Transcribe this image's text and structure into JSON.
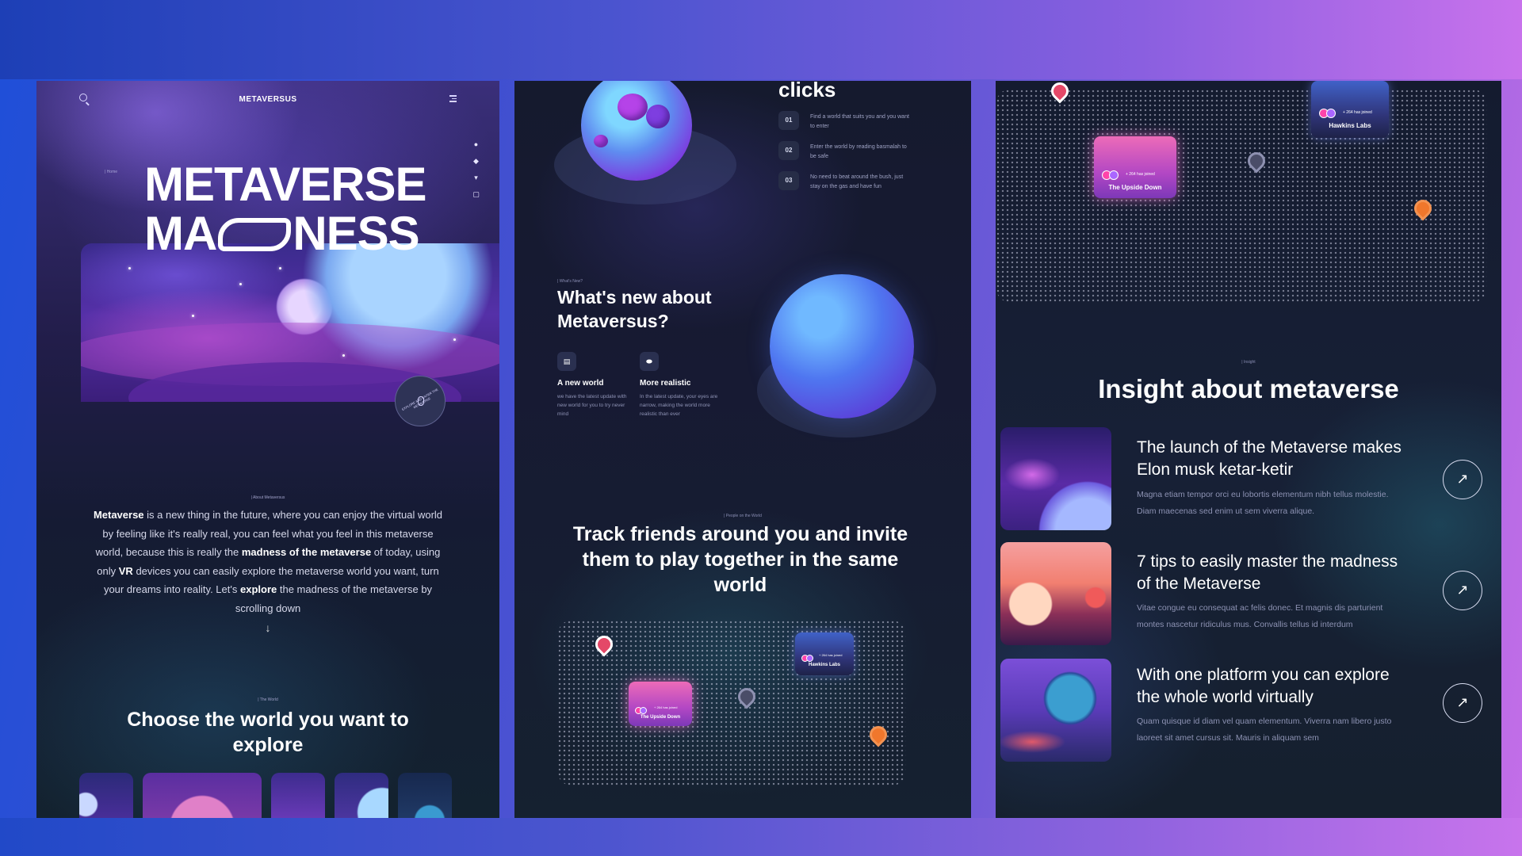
{
  "panel1": {
    "brand": "METAVERSUS",
    "breadcrumb": "| Home",
    "hero_line1": "METAVERSE",
    "hero_line2_a": "MA",
    "hero_line2_b": "NESS",
    "badge_text": "EXPLORE AND ENTER THE METAVERSE",
    "about_label": "| About Metaversus",
    "about": {
      "t1": "Metaverse",
      "t2": " is a new thing in the future, where you can enjoy the virtual world by feeling like it's really real, you can feel what you feel in this metaverse world, because this is really the ",
      "t3": "madness of the metaverse",
      "t4": " of today, using only ",
      "t5": "VR",
      "t6": " devices you can easily explore the metaverse world you want, turn your dreams into reality. Let's ",
      "t7": "explore",
      "t8": " the madness of the metaverse by scrolling down"
    },
    "arrow": "↓",
    "world_label": "| The World",
    "choose": "Choose the world you want to explore"
  },
  "panel2": {
    "clicks": "clicks",
    "steps": [
      {
        "num": "01",
        "text": "Find a world that suits you and you want to enter"
      },
      {
        "num": "02",
        "text": "Enter the world by reading basmalah to be safe"
      },
      {
        "num": "03",
        "text": "No need to beat around the bush, just stay on the gas and have fun"
      }
    ],
    "whats_label": "| What's New?",
    "whats_new": "What's new about Metaversus?",
    "features": [
      {
        "title": "A new world",
        "desc": "we have the latest update with new world for you to try never mind"
      },
      {
        "title": "More realistic",
        "desc": "In the latest update, your eyes are narrow, making the world more realistic than ever"
      }
    ],
    "people_label": "| People on the World",
    "track": "Track friends around you and invite them to play together in the same world",
    "card_upside": {
      "name": "The Upside Down",
      "joined": "+ 264 has joined"
    },
    "card_hawkins": {
      "name": "Hawkins Labs",
      "joined": "+ 264 has joined"
    }
  },
  "panel3": {
    "card_upside": {
      "name": "The Upside Down",
      "joined": "+ 264 has joined"
    },
    "card_hawkins": {
      "name": "Hawkins Labs",
      "joined": "+ 264 has joined"
    },
    "insight_label": "| Insight",
    "insight_title": "Insight about metaverse",
    "posts": [
      {
        "title": "The launch of the Metaverse makes Elon musk ketar-ketir",
        "desc": "Magna etiam tempor orci eu lobortis elementum nibh tellus molestie. Diam maecenas sed enim ut sem viverra alique."
      },
      {
        "title": "7 tips to easily master the madness of the Metaverse",
        "desc": "Vitae congue eu consequat ac felis donec. Et magnis dis parturient montes nascetur ridiculus mus. Convallis tellus id interdum"
      },
      {
        "title": "With one platform you can explore the whole world virtually",
        "desc": "Quam quisque id diam vel quam elementum. Viverra nam libero justo laoreet sit amet cursus sit. Mauris in aliquam sem"
      }
    ],
    "arrow": "↗"
  },
  "icons": {
    "search": "search-icon",
    "menu": "menu-icon",
    "social": [
      "reddit-icon",
      "discord-icon",
      "twitter-icon",
      "instagram-icon"
    ]
  },
  "colors": {
    "background_start": "#1f4fd8",
    "background_end": "#c46ee8",
    "panel": "#131b30",
    "pin_red": "#e44868",
    "pin_orange": "#f0772c",
    "card_pink": "#ed6bb8"
  }
}
